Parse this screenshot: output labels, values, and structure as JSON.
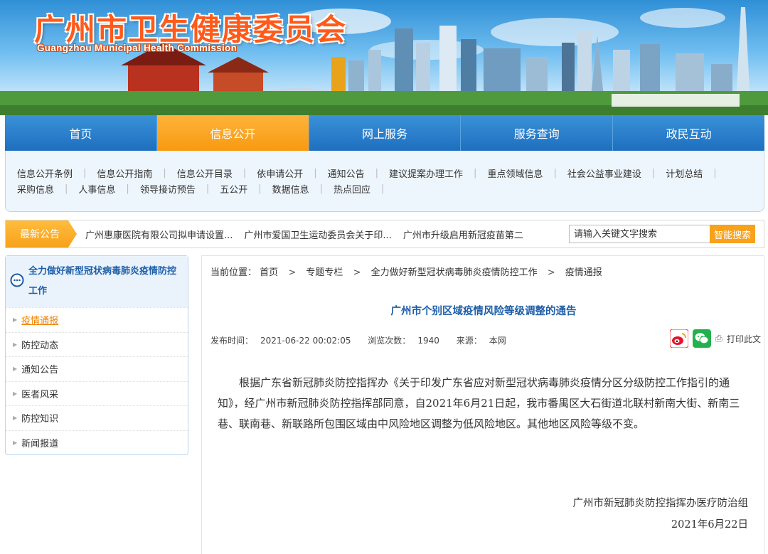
{
  "header": {
    "title": "广州市卫生健康委员会",
    "subtitle": "Guangzhou Municipal Health Commission"
  },
  "main_nav": [
    {
      "label": "首页",
      "active": false
    },
    {
      "label": "信息公开",
      "active": true
    },
    {
      "label": "网上服务",
      "active": false
    },
    {
      "label": "服务查询",
      "active": false
    },
    {
      "label": "政民互动",
      "active": false
    }
  ],
  "sub_nav": {
    "row1": [
      "信息公开条例",
      "信息公开指南",
      "信息公开目录",
      "依申请公开",
      "通知公告",
      "建议提案办理工作",
      "重点领域信息",
      "社会公益事业建设",
      "计划总结"
    ],
    "row2": [
      "采购信息",
      "人事信息",
      "领导接访预告",
      "五公开",
      "数据信息",
      "热点回应"
    ]
  },
  "notice": {
    "label": "最新公告",
    "items": [
      "广州惠康医院有限公司拟申请设置...",
      "广州市爱国卫生运动委员会关于印...",
      "广州市升级启用新冠疫苗第二"
    ],
    "search_placeholder": "请输入关键文字搜索",
    "search_button": "智能搜索"
  },
  "sidebar": {
    "title": "全力做好新型冠状病毒肺炎疫情防控工作",
    "items": [
      {
        "label": "疫情通报",
        "active": true
      },
      {
        "label": "防控动态",
        "active": false
      },
      {
        "label": "通知公告",
        "active": false
      },
      {
        "label": "医者风采",
        "active": false
      },
      {
        "label": "防控知识",
        "active": false
      },
      {
        "label": "新闻报道",
        "active": false
      }
    ]
  },
  "breadcrumb": {
    "prefix": "当前位置：",
    "items": [
      "首页",
      "专题专栏",
      "全力做好新型冠状病毒肺炎疫情防控工作",
      "疫情通报"
    ]
  },
  "article": {
    "title": "广州市个别区域疫情风险等级调整的通告",
    "publish_label": "发布时间：",
    "publish_time": "2021-06-22 00:02:05",
    "views_label": "浏览次数：",
    "views": "1940",
    "source_label": "来源：",
    "source": "本网",
    "print_label": "打印此文",
    "body": "根据广东省新冠肺炎防控指挥办《关于印发广东省应对新型冠状病毒肺炎疫情分区分级防控工作指引的通知》，经广州市新冠肺炎防控指挥部同意，自2021年6月21日起，我市番禺区大石街道北联村新南大街、新南三巷、联南巷、新联路所包围区域由中风险地区调整为低风险地区。其他地区风险等级不变。",
    "signer": "广州市新冠肺炎防控指挥办医疗防治组",
    "date": "2021年6月22日"
  },
  "colors": {
    "nav_blue": "#1e6fbf",
    "nav_active": "#f79a12",
    "title_blue": "#1e5ea8",
    "accent_orange": "#f08300"
  }
}
